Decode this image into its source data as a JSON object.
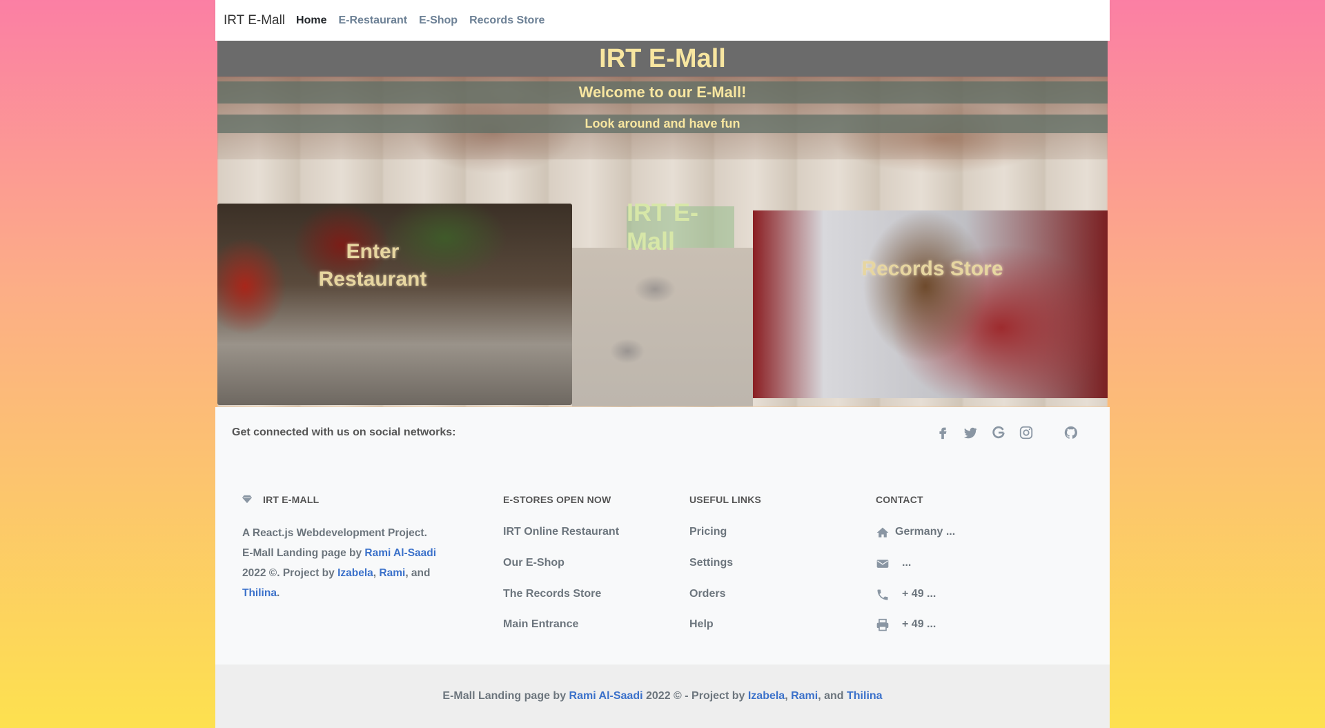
{
  "navbar": {
    "brand": "IRT E-Mall",
    "items": [
      {
        "label": "Home",
        "active": true
      },
      {
        "label": "E-Restaurant"
      },
      {
        "label": "E-Shop"
      },
      {
        "label": "Records Store"
      }
    ]
  },
  "hero": {
    "title": "IRT E-Mall",
    "welcome": "Welcome to our E-Mall!",
    "tagline": "Look around and have fun",
    "restaurant_label": "Enter Restaurant",
    "center_label": "IRT E-Mall",
    "records_label": "Records Store"
  },
  "social": {
    "text": "Get connected with us on social networks:",
    "icons": [
      "facebook-icon",
      "twitter-icon",
      "google-icon",
      "instagram-icon",
      "github-icon"
    ]
  },
  "footer": {
    "about": {
      "heading": "IRT E-Mall",
      "line1": "A React.js Webdevelopment Project.",
      "line2_prefix": "E-Mall Landing page by ",
      "author": "Rami Al-Saadi",
      "line3_prefix": "2022 ©. Project by ",
      "member1": "Izabela",
      "member2": "Rami",
      "sep": ", ",
      "and": ", and",
      "member3": "Thilina",
      "end": "."
    },
    "stores": {
      "heading": "E-Stores open now",
      "items": [
        "IRT Online Restaurant",
        "Our E-Shop",
        "The Records Store",
        "Main Entrance"
      ]
    },
    "useful": {
      "heading": "Useful links",
      "items": [
        "Pricing",
        "Settings",
        "Orders",
        "Help"
      ]
    },
    "contact": {
      "heading": "Contact",
      "address": "Germany ...",
      "email": "...",
      "phone": "+ 49 ...",
      "fax": "+ 49 ..."
    }
  },
  "copyright": {
    "prefix": "E-Mall Landing page by ",
    "author": "Rami Al-Saadi",
    "middle": " 2022 © - Project by ",
    "member1": "Izabela",
    "sep": ", ",
    "member2": "Rami",
    "and": ", and ",
    "member3": "Thilina"
  },
  "colors": {
    "link": "#3b71ca",
    "hero_text": "#f8e6a0",
    "gradient_top": "#fb7fa4",
    "gradient_bottom": "#fde14f"
  }
}
